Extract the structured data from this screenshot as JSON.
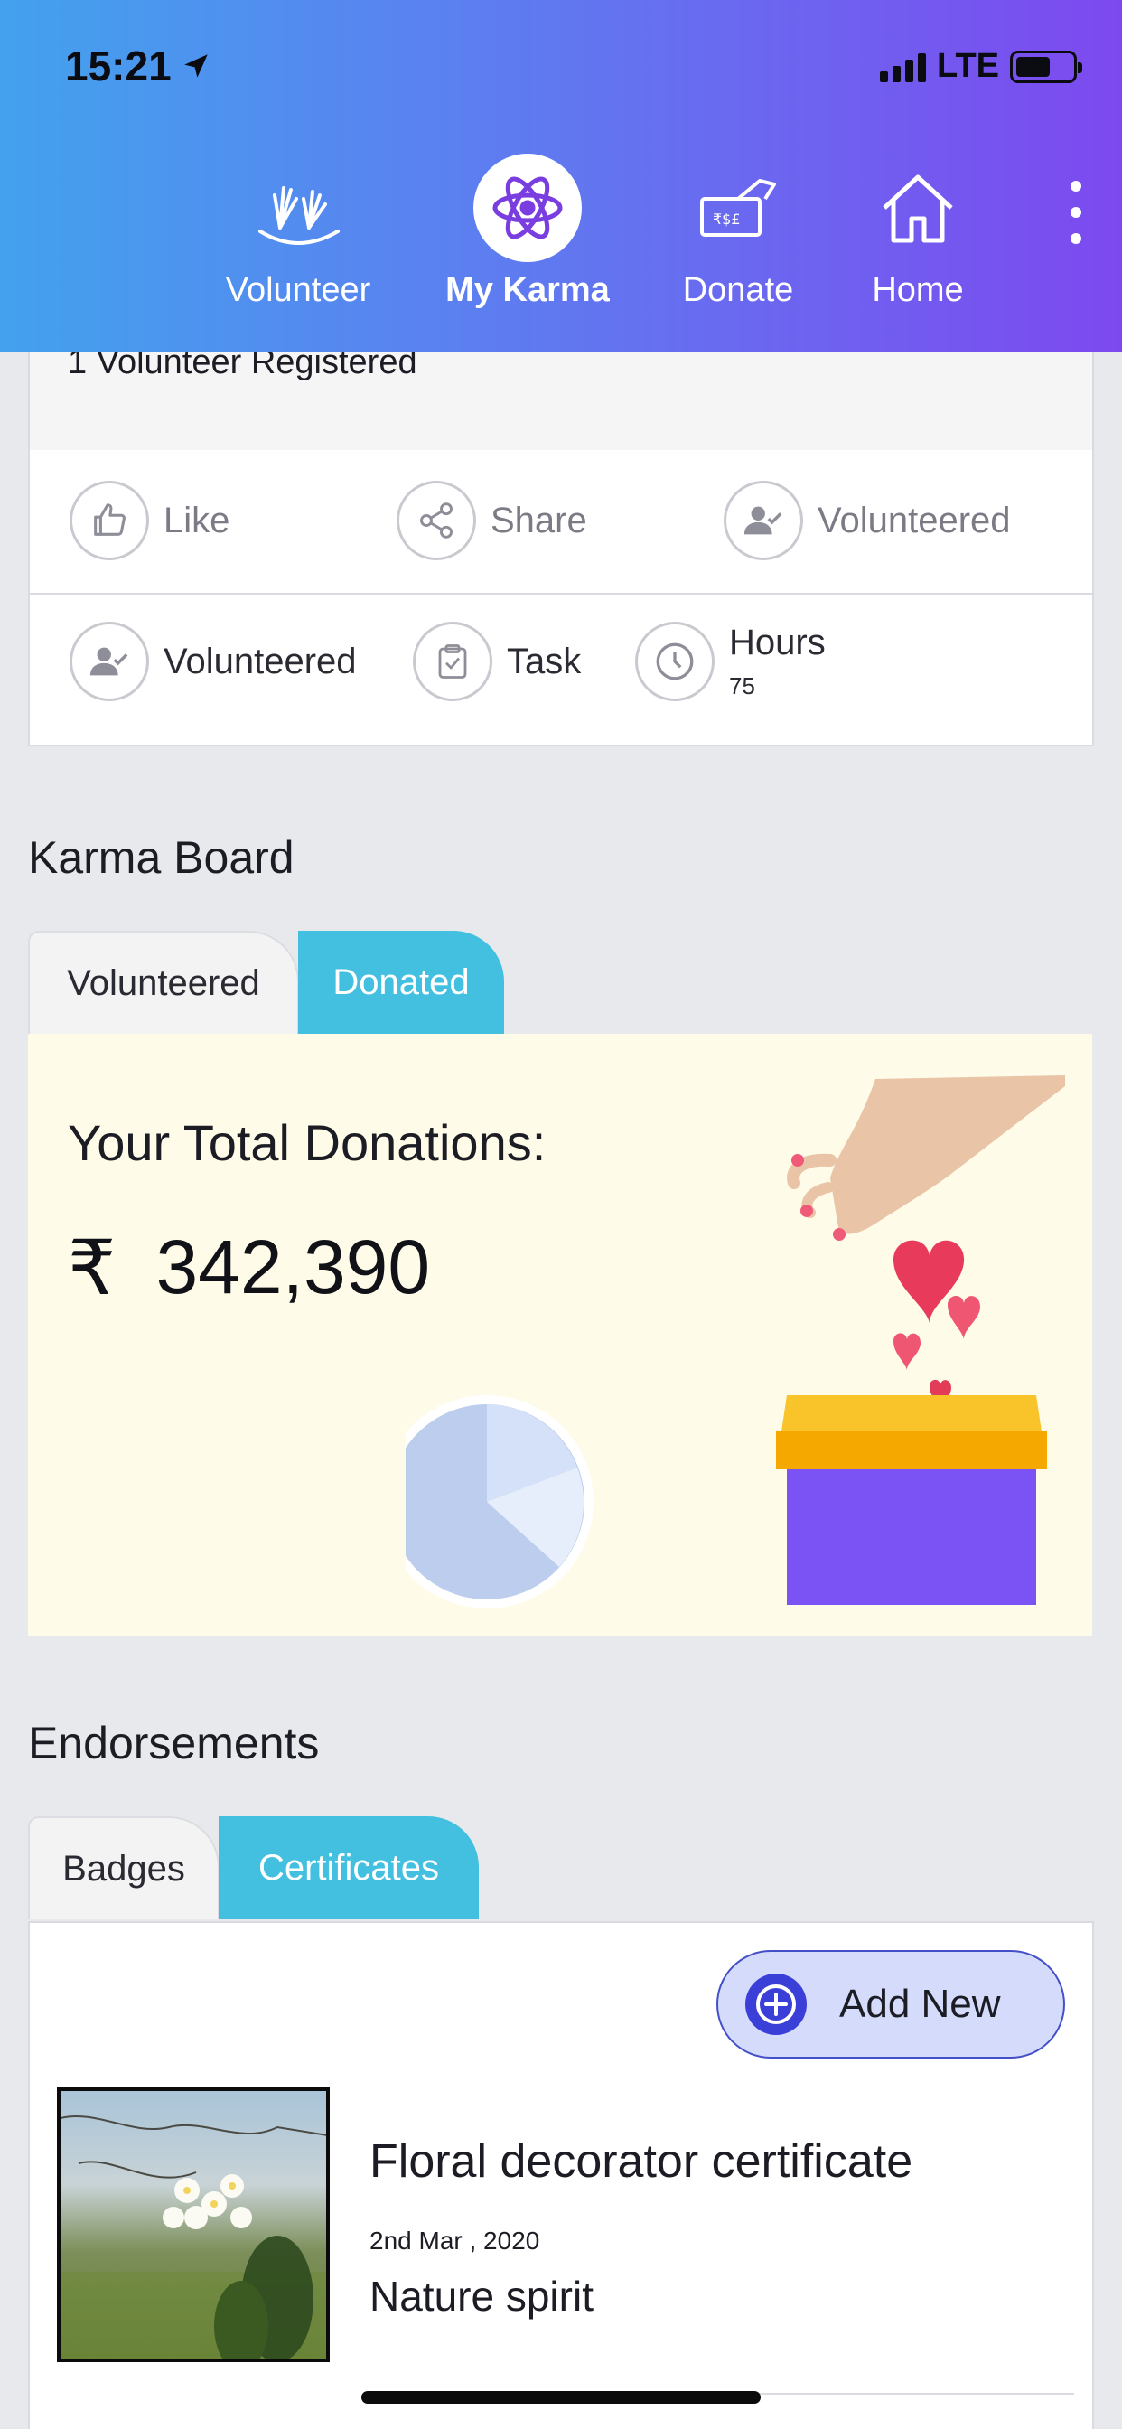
{
  "status_bar": {
    "time": "15:21",
    "network": "LTE"
  },
  "nav": {
    "items": [
      {
        "label": "Volunteer",
        "icon": "hands-raised-icon"
      },
      {
        "label": "My Karma",
        "icon": "karma-atom-icon",
        "active": true
      },
      {
        "label": "Donate",
        "icon": "donate-hand-money-icon"
      },
      {
        "label": "Home",
        "icon": "home-icon"
      }
    ],
    "more_icon": "more-vertical-icon"
  },
  "activity": {
    "registered_text": "1 Volunteer Registered",
    "row1": {
      "like": "Like",
      "share": "Share",
      "volunteered": "Volunteered"
    },
    "row2": {
      "volunteered": "Volunteered",
      "task": "Task",
      "hours_label": "Hours",
      "hours_value": "75"
    }
  },
  "karma_board": {
    "title": "Karma Board",
    "tabs": {
      "volunteered": "Volunteered",
      "donated": "Donated"
    },
    "total_label": "Your Total Donations:",
    "currency": "₹",
    "total_amount": "342,390"
  },
  "endorsements": {
    "title": "Endorsements",
    "tabs": {
      "badges": "Badges",
      "certificates": "Certificates"
    },
    "add_new": "Add New",
    "certificate": {
      "name": "Floral decorator certificate",
      "date": "2nd Mar , 2020",
      "issuer": "Nature spirit"
    }
  },
  "colors": {
    "header_start": "#43a2ee",
    "header_end": "#7d49ef",
    "tab_active": "#43bfe0",
    "add_button": "#d5dbfb",
    "donation_panel": "#fefbe8"
  }
}
